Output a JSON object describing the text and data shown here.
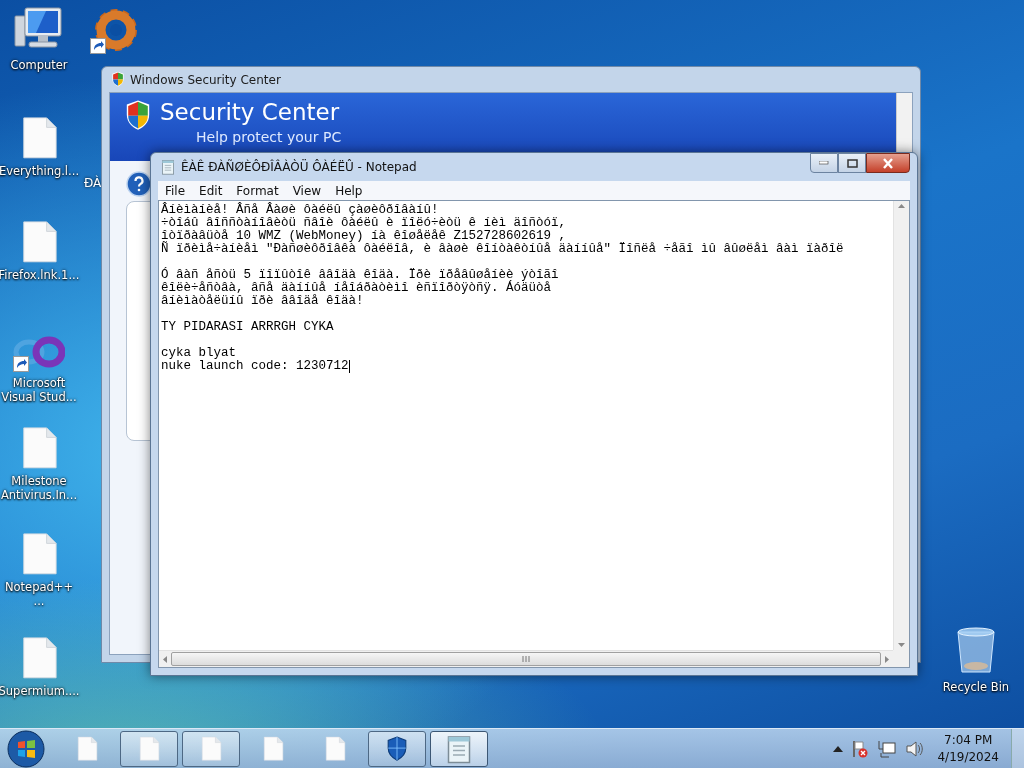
{
  "desktop": {
    "icons": [
      {
        "label": "Computer",
        "kind": "computer",
        "shortcut": false
      },
      {
        "kind": "gear",
        "shortcut": true
      },
      {
        "label": "Everything.l...",
        "kind": "document",
        "shortcut": false
      },
      {
        "label": "Firefox.lnk.1...",
        "kind": "document",
        "shortcut": false
      },
      {
        "label": "Microsoft Visual Stud...",
        "kind": "loop",
        "shortcut": true
      },
      {
        "label": "Milestone Antivirus.In...",
        "kind": "document",
        "shortcut": false
      },
      {
        "label": "Notepad++ ...",
        "kind": "document",
        "shortcut": false
      },
      {
        "label": "Supermium....",
        "kind": "document",
        "shortcut": false
      },
      {
        "label": "Recycle Bin",
        "kind": "bin",
        "shortcut": false
      }
    ],
    "hidden_label": "ÐÀ"
  },
  "security_center": {
    "title": "Windows Security Center",
    "heading": "Security Center",
    "subtitle": "Help protect your PC"
  },
  "notepad": {
    "title": "ÊÀÊ ÐÀÑØÈÔÐÎÂÀÒÜ ÔÀÉËÛ - Notepad",
    "menu": [
      "File",
      "Edit",
      "Format",
      "View",
      "Help"
    ],
    "paragraphs": [
      [
        "Âíèìàíèå! Âñå Âàøè ôàéëû çàøèôðîâàíû!",
        "÷òîáû âîññòàíîâèòü ñâîè ôàéëû è ïîëó÷èòü ê íèì äîñòóï,",
        "îòïðàâüòå 10 WMZ (WebMoney) íà êîøåëåê Z152728602619 ,",
        "Ñ ïðèìå÷àíèåì \"Ðàñøèôðîâêà ôàéëîâ, è âàøè êîíòàêòíûå äàííûå\" Ïîñëå ÷åãî ìû âûøëåì âàì ïàðîë"
      ],
      [
        "Ó âàñ åñòü 5 ïîïûòîê ââîäà êîäà. Ïðè ïðåâûøåíèè ýòîãî",
        "êîëè÷åñòâà, âñå äàííûå íåîáðàòèìî èñïîðòÿòñÿ. Áóäüòå",
        "âíèìàòåëüíû ïðè ââîäå êîäà!"
      ],
      [
        "TY PIDARASI ARRRGH CYKA"
      ],
      [
        "cyka blyat",
        "nuke launch code: 1230712"
      ]
    ]
  },
  "taskbar": {
    "buttons": [
      {
        "kind": "document",
        "running": false,
        "selected": false
      },
      {
        "kind": "document",
        "running": true,
        "selected": false
      },
      {
        "kind": "document",
        "running": true,
        "selected": false
      },
      {
        "kind": "document",
        "running": false,
        "selected": false
      },
      {
        "kind": "document",
        "running": false,
        "selected": false
      },
      {
        "kind": "shield",
        "running": true,
        "selected": false
      },
      {
        "kind": "notepad",
        "running": true,
        "selected": true
      }
    ],
    "time": "7:04 PM",
    "date": "4/19/2024"
  }
}
